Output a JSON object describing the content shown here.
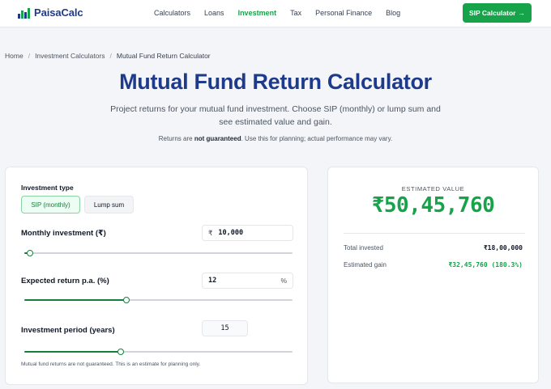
{
  "header": {
    "brand": "PaisaCalc",
    "nav": [
      "Calculators",
      "Loans",
      "Investment",
      "Tax",
      "Personal Finance",
      "Blog"
    ],
    "active_nav": "Investment",
    "cta_label": "SIP Calculator",
    "cta_arrow": "→"
  },
  "breadcrumb": {
    "items": [
      "Home",
      "Investment Calculators",
      "Mutual Fund Return Calculator"
    ],
    "separator": "/"
  },
  "hero": {
    "title": "Mutual Fund Return Calculator",
    "subtitle": "Project returns for your mutual fund investment. Choose SIP (monthly) or lump sum and see estimated value and gain.",
    "note_prefix": "Returns are ",
    "note_bold": "not guaranteed",
    "note_suffix": ". Use this for planning; actual performance may vary."
  },
  "form": {
    "investment_type_label": "Investment type",
    "options": [
      "SIP (monthly)",
      "Lump sum"
    ],
    "selected_option": "SIP (monthly)",
    "monthly_label": "Monthly investment (₹)",
    "monthly_prefix": "₹",
    "monthly_value": "10,000",
    "monthly_slider_fraction": 0.02,
    "return_label": "Expected return p.a. (%)",
    "return_value": "12",
    "return_suffix": "%",
    "return_slider_fraction": 0.38,
    "period_label": "Investment period (years)",
    "period_value": "15",
    "period_slider_fraction": 0.36,
    "disclaimer": "Mutual fund returns are not guaranteed. This is an estimate for planning only."
  },
  "result": {
    "estimated_label": "ESTIMATED VALUE",
    "estimated_value": "₹50,45,760",
    "total_invested_label": "Total invested",
    "total_invested_value": "₹18,00,000",
    "gain_label": "Estimated gain",
    "gain_value": "₹32,45,760 (180.3%)"
  },
  "colors": {
    "brand": "#1e3a8a",
    "accent": "#16a34a",
    "background": "#f3f5f8"
  }
}
